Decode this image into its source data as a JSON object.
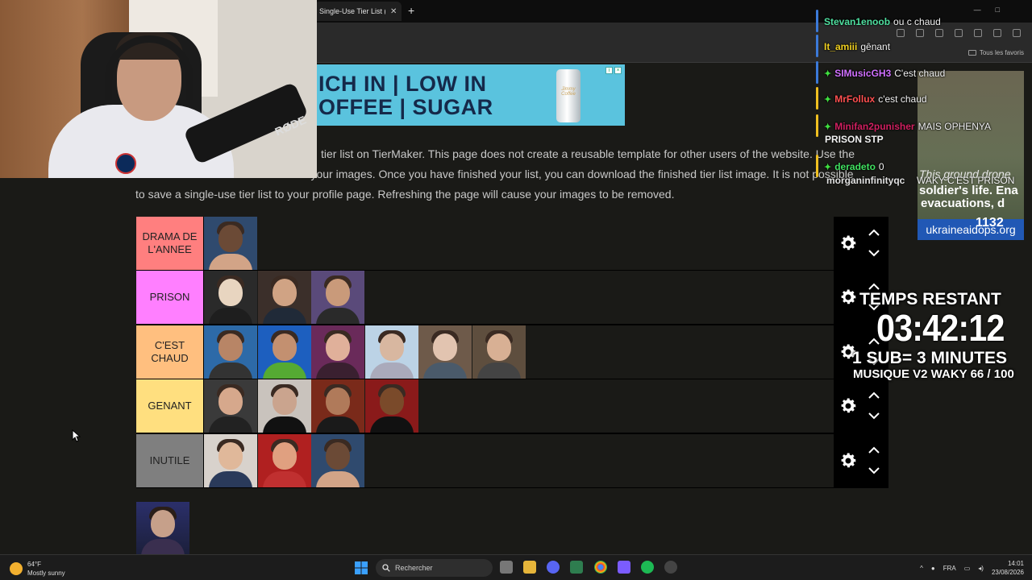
{
  "browser": {
    "tab_title": "Single-Use Tier List (P",
    "tab_close": "✕",
    "new_tab": "+",
    "bookmarks_folder": "Tous les favoris"
  },
  "ad": {
    "line1": "ICH IN | LOW IN",
    "line2": "OFFEE | SUGAR",
    "can_text": "Jimmy Coffee"
  },
  "description": {
    "line1": "tier list on TierMaker. This page does not create a reusable template for other users of the website. Use the",
    "line2": "dd your images. Once you have finished your list, you can download the finished tier list image. It is not possible",
    "line3": "to save a single-use tier list to your profile page. Refreshing the page will cause your images to be removed."
  },
  "tiers": [
    {
      "label": "DRAMA DE L'ANNEE",
      "color": "#ff7f7f",
      "count": 1
    },
    {
      "label": "PRISON",
      "color": "#ff7fff",
      "count": 3
    },
    {
      "label": "C'EST CHAUD",
      "color": "#ffbf7f",
      "count": 6
    },
    {
      "label": "GENANT",
      "color": "#ffdf7f",
      "count": 4
    },
    {
      "label": "INUTILE",
      "color": "#7f7f7f",
      "count": 3
    }
  ],
  "cam": {
    "mic_brand": "RØDE"
  },
  "chat": [
    {
      "user": "Stevan1enoob",
      "text": "ou c chaud",
      "color": "#4fe0a0",
      "bar": "#3b7ad9"
    },
    {
      "user": "It_amiii",
      "text": "gênant",
      "color": "#f0d020",
      "bar": "#3b7ad9"
    },
    {
      "user": "SIMusicGH3",
      "text": "C'est chaud",
      "color": "#d070ff",
      "bar": "#3b7ad9"
    },
    {
      "user": "MrFollux",
      "text": "c'est chaud",
      "color": "#ff5050",
      "bar": "#f0c020"
    },
    {
      "user": "Minifan2punisher",
      "text": "MAIS OPHENYA",
      "color": "#d02060",
      "bar": "#f0c020"
    },
    {
      "user": "deradeto",
      "text": "0",
      "color": "#40e060",
      "bar": "#f0c020"
    }
  ],
  "chat_extra": {
    "continuation": "PRISON STP",
    "partial_user": "morganinfinityqc",
    "partial_text": "WAKY C'EST PRISON"
  },
  "news": {
    "line1": "This ground drone",
    "line2": "soldier's life. Ena",
    "line3": "evacuations, d",
    "count": "1132",
    "url": "ukraineaidops.org"
  },
  "timer": {
    "title": "TEMPS RESTANT",
    "value": "03:42:12",
    "sub": "1 SUB= 3 MINUTES",
    "music": "MUSIQUE V2 WAKY 66 / 100"
  },
  "taskbar": {
    "temp": "64°F",
    "weather": "Mostly sunny",
    "search": "Rechercher",
    "lang": "FRA",
    "time": "14:01",
    "date": "23/08/2026"
  }
}
